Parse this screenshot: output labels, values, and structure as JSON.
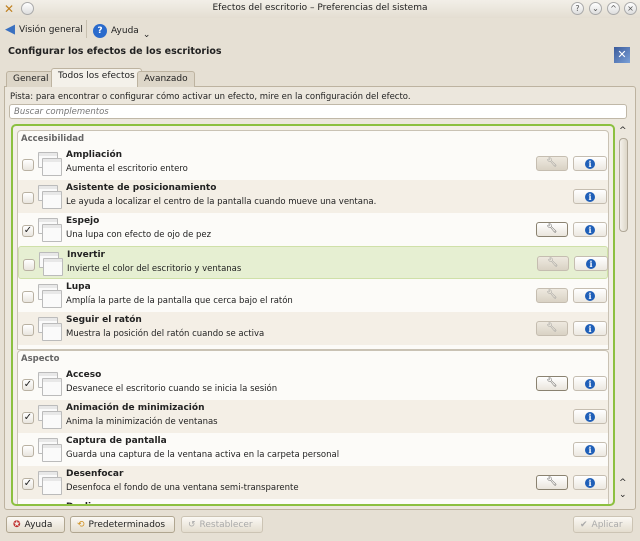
{
  "window": {
    "title": "Efectos del escritorio – Preferencias del sistema"
  },
  "toolbar": {
    "overview": "Visión general",
    "help": "Ayuda"
  },
  "heading": "Configurar los efectos de los escritorios",
  "tabs": [
    {
      "label": "General"
    },
    {
      "label": "Todos los efectos"
    },
    {
      "label": "Avanzado"
    }
  ],
  "hint": "Pista: para encontrar o configurar cómo activar un efecto, mire en la configuración del efecto.",
  "search": {
    "placeholder": "Buscar complementos"
  },
  "groups": [
    {
      "title": "Accesibilidad",
      "effects": [
        {
          "name": "Ampliación",
          "desc": "Aumenta el escritorio entero",
          "checked": false,
          "configurable": true,
          "config_enabled": false
        },
        {
          "name": "Asistente de posicionamiento",
          "desc": "Le ayuda a localizar el centro de la pantalla cuando mueve una ventana.",
          "checked": false,
          "configurable": false
        },
        {
          "name": "Espejo",
          "desc": "Una lupa con efecto de ojo de pez",
          "checked": true,
          "configurable": true,
          "config_enabled": true
        },
        {
          "name": "Invertir",
          "desc": "Invierte el color del escritorio y ventanas",
          "checked": false,
          "configurable": true,
          "config_enabled": false,
          "highlighted": true
        },
        {
          "name": "Lupa",
          "desc": "Amplía la parte de la pantalla que cerca bajo el ratón",
          "checked": false,
          "configurable": true,
          "config_enabled": false
        },
        {
          "name": "Seguir el ratón",
          "desc": "Muestra la posición del ratón cuando se activa",
          "checked": false,
          "configurable": true,
          "config_enabled": false
        }
      ]
    },
    {
      "title": "Aspecto",
      "effects": [
        {
          "name": "Acceso",
          "desc": "Desvanece el escritorio cuando se inicia la sesión",
          "checked": true,
          "configurable": true,
          "config_enabled": true
        },
        {
          "name": "Animación de minimización",
          "desc": "Anima la minimización de ventanas",
          "checked": true,
          "configurable": false
        },
        {
          "name": "Captura de pantalla",
          "desc": "Guarda una captura de la ventana activa en la carpeta personal",
          "checked": false,
          "configurable": false
        },
        {
          "name": "Desenfocar",
          "desc": "Desenfoca el fondo de una ventana semi-transparente",
          "checked": true,
          "configurable": true,
          "config_enabled": true
        },
        {
          "name": "Deslizar",
          "desc": "",
          "checked": false,
          "configurable": false
        }
      ]
    }
  ],
  "buttons": {
    "help": "Ayuda",
    "defaults": "Predeterminados",
    "reset": "Restablecer",
    "apply": "Aplicar"
  },
  "colors": {
    "accent": "#8cc040",
    "highlight": "#e6efd2"
  }
}
